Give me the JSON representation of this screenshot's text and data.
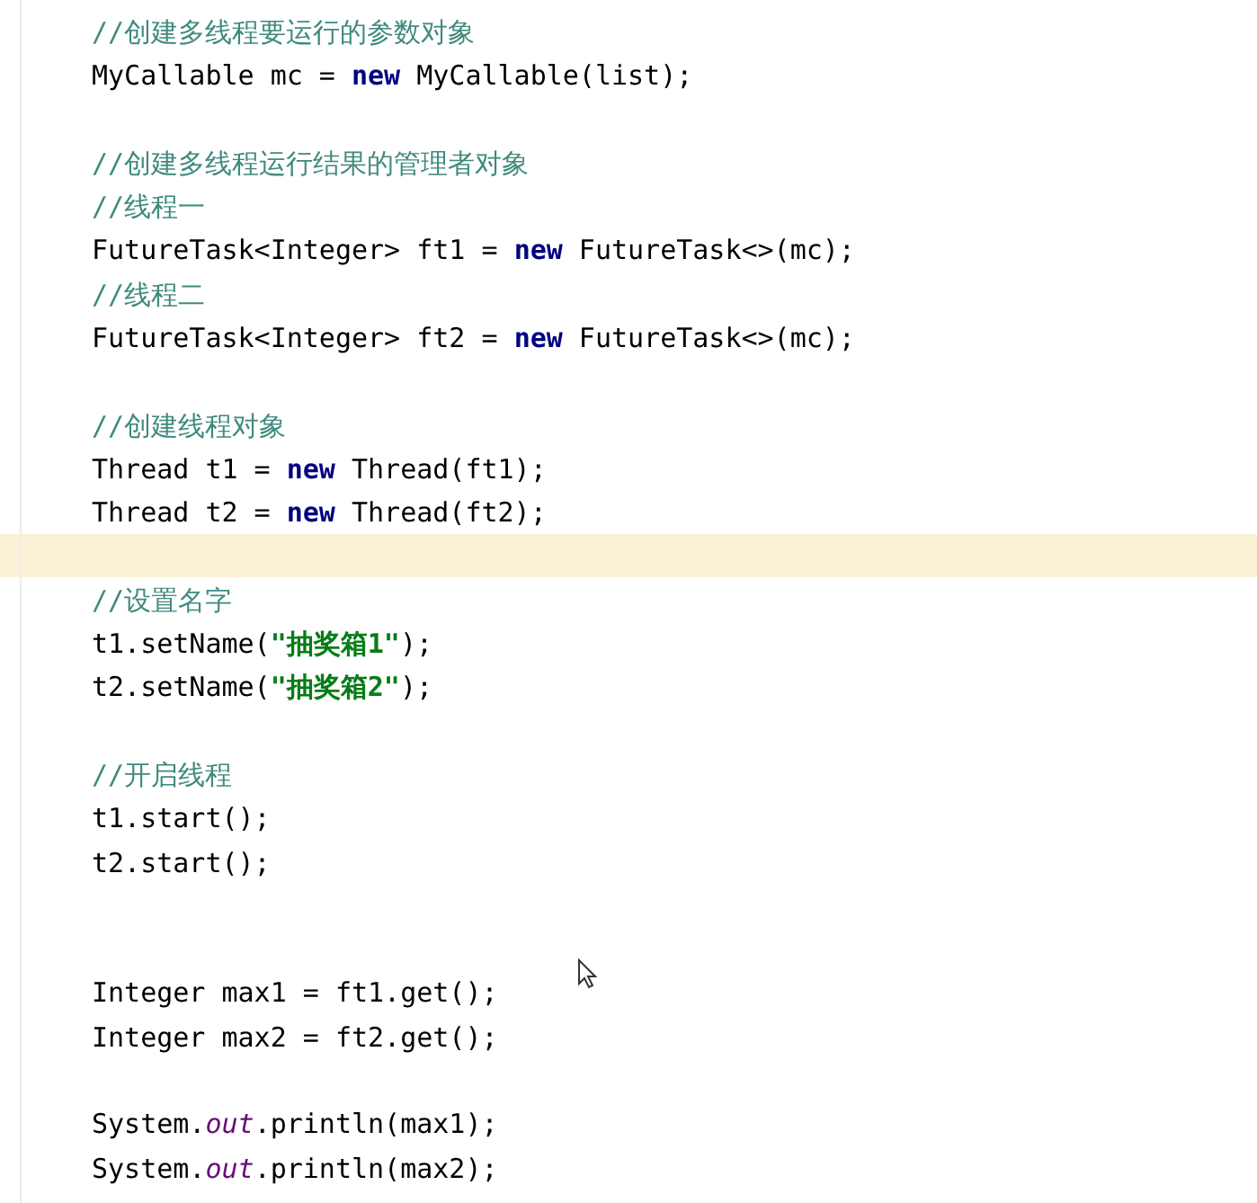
{
  "editor": {
    "lines": [
      {
        "current": false,
        "tokens": [
          {
            "text": "//创建多线程要运行的参数对象",
            "kind": "comment"
          }
        ]
      },
      {
        "current": false,
        "tokens": [
          {
            "text": "MyCallable mc = ",
            "kind": "plain"
          },
          {
            "text": "new",
            "kind": "keyword"
          },
          {
            "text": " MyCallable(list);",
            "kind": "plain"
          }
        ]
      },
      {
        "current": false
      },
      {
        "current": false,
        "tokens": [
          {
            "text": "//创建多线程运行结果的管理者对象",
            "kind": "comment"
          }
        ]
      },
      {
        "current": false,
        "tokens": [
          {
            "text": "//线程一",
            "kind": "comment"
          }
        ]
      },
      {
        "current": false,
        "tokens": [
          {
            "text": "FutureTask<Integer> ft1 = ",
            "kind": "plain"
          },
          {
            "text": "new",
            "kind": "keyword"
          },
          {
            "text": " FutureTask<>(mc);",
            "kind": "plain"
          }
        ]
      },
      {
        "current": false,
        "tokens": [
          {
            "text": "//线程二",
            "kind": "comment"
          }
        ]
      },
      {
        "current": false,
        "tokens": [
          {
            "text": "FutureTask<Integer> ft2 = ",
            "kind": "plain"
          },
          {
            "text": "new",
            "kind": "keyword"
          },
          {
            "text": " FutureTask<>(mc);",
            "kind": "plain"
          }
        ]
      },
      {
        "current": false
      },
      {
        "current": false,
        "tokens": [
          {
            "text": "//创建线程对象",
            "kind": "comment"
          }
        ]
      },
      {
        "current": false,
        "tokens": [
          {
            "text": "Thread t1 = ",
            "kind": "plain"
          },
          {
            "text": "new",
            "kind": "keyword"
          },
          {
            "text": " Thread(ft1);",
            "kind": "plain"
          }
        ]
      },
      {
        "current": false,
        "tokens": [
          {
            "text": "Thread t2 = ",
            "kind": "plain"
          },
          {
            "text": "new",
            "kind": "keyword"
          },
          {
            "text": " Thread(ft2);",
            "kind": "plain"
          }
        ]
      },
      {
        "current": true
      },
      {
        "current": false,
        "tokens": [
          {
            "text": "//设置名字",
            "kind": "comment"
          }
        ]
      },
      {
        "current": false,
        "tokens": [
          {
            "text": "t1.setName(",
            "kind": "plain"
          },
          {
            "text": "\"抽奖箱1\"",
            "kind": "string"
          },
          {
            "text": ");",
            "kind": "plain"
          }
        ]
      },
      {
        "current": false,
        "tokens": [
          {
            "text": "t2.setName(",
            "kind": "plain"
          },
          {
            "text": "\"抽奖箱2\"",
            "kind": "string"
          },
          {
            "text": ");",
            "kind": "plain"
          }
        ]
      },
      {
        "current": false
      },
      {
        "current": false,
        "tokens": [
          {
            "text": "//开启线程",
            "kind": "comment"
          }
        ]
      },
      {
        "current": false,
        "tokens": [
          {
            "text": "t1.start();",
            "kind": "plain"
          }
        ]
      },
      {
        "current": false,
        "tokens": [
          {
            "text": "t2.start();",
            "kind": "plain"
          }
        ]
      },
      {
        "current": false
      },
      {
        "current": false
      },
      {
        "current": false,
        "tokens": [
          {
            "text": "Integer max1 = ft1.get();",
            "kind": "plain"
          }
        ]
      },
      {
        "current": false,
        "tokens": [
          {
            "text": "Integer max2 = ft2.get();",
            "kind": "plain"
          }
        ]
      },
      {
        "current": false
      },
      {
        "current": false,
        "tokens": [
          {
            "text": "System.",
            "kind": "plain"
          },
          {
            "text": "out",
            "kind": "static_field"
          },
          {
            "text": ".println(max1);",
            "kind": "plain"
          }
        ]
      },
      {
        "current": false,
        "tokens": [
          {
            "text": "System.",
            "kind": "plain"
          },
          {
            "text": "out",
            "kind": "static_field"
          },
          {
            "text": ".println(max2);",
            "kind": "plain"
          }
        ]
      }
    ]
  }
}
